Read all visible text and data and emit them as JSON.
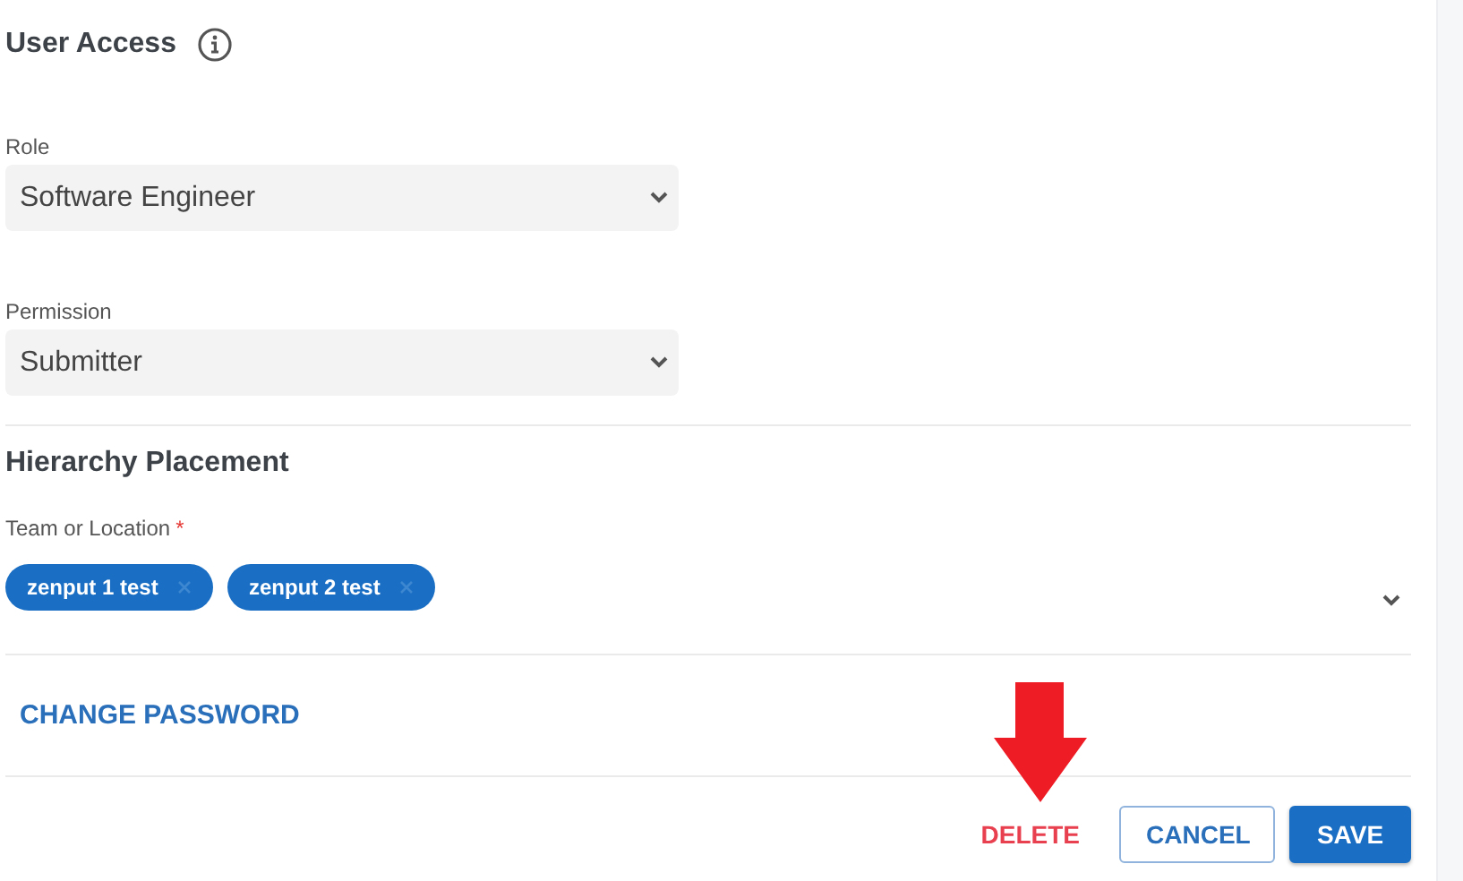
{
  "user_access": {
    "title": "User Access",
    "fields": [
      {
        "label": "Role",
        "value": "Software Engineer"
      },
      {
        "label": "Permission",
        "value": "Submitter"
      }
    ]
  },
  "hierarchy": {
    "title": "Hierarchy Placement",
    "label": "Team or Location",
    "required_mark": "*",
    "chips": [
      {
        "label": "zenput 1 test"
      },
      {
        "label": "zenput 2 test"
      }
    ]
  },
  "change_password": "CHANGE PASSWORD",
  "actions": [
    {
      "kind": "text",
      "label": "DELETE"
    },
    {
      "kind": "outlined",
      "label": "CANCEL"
    },
    {
      "kind": "filled",
      "label": "SAVE"
    }
  ]
}
